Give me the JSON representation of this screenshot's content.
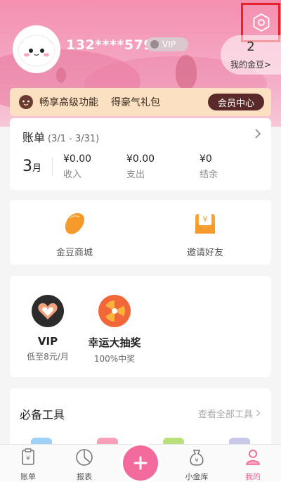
{
  "header": {
    "phone": "132****5790",
    "vip_badge": "VIP",
    "gold_count": "2",
    "gold_label": "我的金豆>"
  },
  "banner": {
    "text1": "畅享高级功能",
    "text2": "得豪气礼包",
    "button": "会员中心"
  },
  "bill": {
    "title": "账单",
    "range": "(3/1 - 3/31)",
    "month_num": "3",
    "month_unit": "月",
    "stats": [
      {
        "value": "¥0.00",
        "label": "收入"
      },
      {
        "value": "¥0.00",
        "label": "支出"
      },
      {
        "value": "¥0",
        "label": "结余"
      }
    ]
  },
  "mall": {
    "items": [
      {
        "label": "金豆商城",
        "icon": "gold-bean-icon"
      },
      {
        "label": "邀请好友",
        "icon": "invite-envelope-icon"
      }
    ]
  },
  "promos": [
    {
      "title": "VIP",
      "subtitle": "低至8元/月",
      "icon": "vip-heart-icon"
    },
    {
      "title": "幸运大抽奖",
      "subtitle": "100%中奖",
      "icon": "lucky-wheel-icon"
    }
  ],
  "tools": {
    "title": "必备工具",
    "view_all": "查看全部工具"
  },
  "tabbar": {
    "items": [
      {
        "label": "账单",
        "icon": "bill-icon",
        "active": false
      },
      {
        "label": "报表",
        "icon": "chart-icon",
        "active": false
      },
      {
        "label": "小金库",
        "icon": "moneybag-icon",
        "active": false
      },
      {
        "label": "我的",
        "icon": "profile-icon",
        "active": true
      }
    ],
    "add": "+"
  },
  "colors": {
    "accent": "#f26b9c",
    "header_pink": "#f58fb0",
    "banner_bg": "#fbe0c2",
    "member_btn": "#5a2a2a",
    "highlight_box": "#e8222b"
  }
}
